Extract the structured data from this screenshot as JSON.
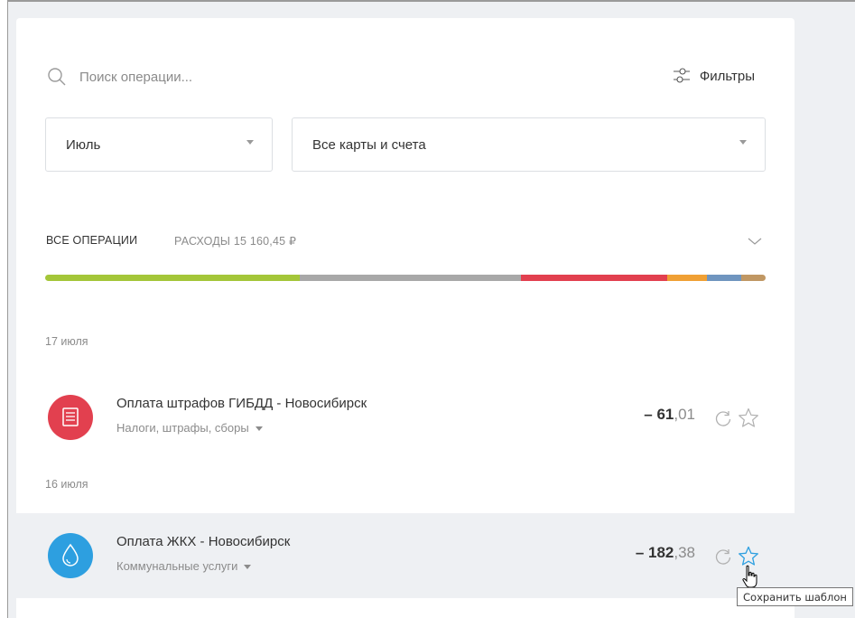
{
  "search": {
    "placeholder": "Поиск операции..."
  },
  "filters": {
    "label": "Фильтры"
  },
  "selects": {
    "month": "Июль",
    "cards": "Все карты и счета"
  },
  "tabs": {
    "all": "ВСЕ ОПЕРАЦИИ",
    "expenses": "РАСХОДЫ 15 160,45 ₽"
  },
  "spending_bar": [
    {
      "category": "green",
      "fraction": 0.353,
      "color": "#a4c639"
    },
    {
      "category": "gray",
      "fraction": 0.307,
      "color": "#a8a8a8"
    },
    {
      "category": "red",
      "fraction": 0.204,
      "color": "#e2404f"
    },
    {
      "category": "orange",
      "fraction": 0.055,
      "color": "#f0a034"
    },
    {
      "category": "blue",
      "fraction": 0.047,
      "color": "#6f95bf"
    },
    {
      "category": "brown",
      "fraction": 0.034,
      "color": "#c09763"
    }
  ],
  "groups": [
    {
      "date": "17 июля",
      "transactions": [
        {
          "title": "Оплата штрафов ГИБДД - Новосибирск",
          "category": "Налоги, штрафы, сборы",
          "amount_main": "– 61",
          "amount_cents": ",01",
          "icon": "receipt-icon",
          "icon_color": "#e2404f"
        }
      ]
    },
    {
      "date": "16 июля",
      "transactions": [
        {
          "title": "Оплата ЖКХ - Новосибирск",
          "category": "Коммунальные услуги",
          "amount_main": "– 182",
          "amount_cents": ",38",
          "icon": "water-drop-icon",
          "icon_color": "#2d9fe0"
        }
      ]
    }
  ],
  "tooltip": "Сохранить шаблон",
  "colors": {
    "accent": "#2d9fe0",
    "hover_row": "#eef0f3"
  }
}
